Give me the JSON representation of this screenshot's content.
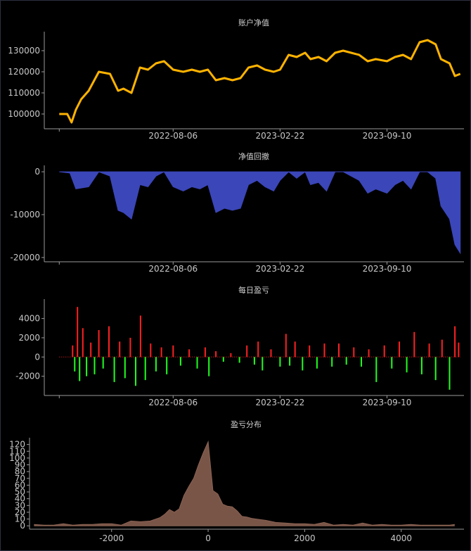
{
  "chart_data": [
    {
      "type": "line",
      "title": "账户净值",
      "xlabel": "",
      "ylabel": "",
      "x_ticks": [
        "2022-08-06",
        "2023-02-22",
        "2023-09-10"
      ],
      "y_ticks": [
        "100000",
        "110000",
        "120000",
        "130000"
      ],
      "ylim": [
        93000,
        138000
      ],
      "color": "#ffb300",
      "series": [
        {
          "x": [
            "2022-01-05",
            "2022-01-20",
            "2022-01-28",
            "2022-02-05",
            "2022-02-15",
            "2022-03-01",
            "2022-03-20",
            "2022-04-10",
            "2022-04-25",
            "2022-05-05",
            "2022-05-20",
            "2022-06-05",
            "2022-06-20",
            "2022-07-05",
            "2022-07-20",
            "2022-08-06",
            "2022-08-25",
            "2022-09-10",
            "2022-09-25",
            "2022-10-10",
            "2022-10-25",
            "2022-11-10",
            "2022-11-25",
            "2022-12-10",
            "2022-12-25",
            "2023-01-10",
            "2023-01-25",
            "2023-02-10",
            "2023-02-22",
            "2023-03-10",
            "2023-03-25",
            "2023-04-10",
            "2023-04-20",
            "2023-05-05",
            "2023-05-20",
            "2023-06-05",
            "2023-06-20",
            "2023-07-05",
            "2023-07-20",
            "2023-08-05",
            "2023-08-20",
            "2023-09-10",
            "2023-09-25",
            "2023-10-10",
            "2023-10-25",
            "2023-11-10",
            "2023-11-25",
            "2023-12-10",
            "2023-12-20",
            "2024-01-05",
            "2024-01-15",
            "2024-01-25"
          ],
          "y": [
            100000,
            100000,
            96000,
            102000,
            107000,
            111000,
            120000,
            119000,
            111000,
            112000,
            110000,
            122000,
            121000,
            124000,
            125000,
            121000,
            120000,
            121000,
            120000,
            121000,
            116000,
            117000,
            116000,
            117000,
            122000,
            123000,
            121000,
            120000,
            121000,
            128000,
            127000,
            129000,
            126000,
            127000,
            125000,
            129000,
            130000,
            129000,
            128000,
            125000,
            126000,
            125000,
            127000,
            128000,
            126000,
            134000,
            135000,
            133000,
            126000,
            124000,
            118000,
            119000
          ]
        }
      ]
    },
    {
      "type": "area",
      "title": "净值回撤",
      "xlabel": "",
      "ylabel": "",
      "x_ticks": [
        "2022-08-06",
        "2023-02-22",
        "2023-09-10"
      ],
      "y_ticks": [
        "0",
        "-10000",
        "-20000"
      ],
      "ylim": [
        -21000,
        1000
      ],
      "color": "#3b46b8",
      "series": [
        {
          "x": [
            "2022-01-05",
            "2022-01-25",
            "2022-02-05",
            "2022-03-01",
            "2022-03-20",
            "2022-04-10",
            "2022-04-25",
            "2022-05-05",
            "2022-05-20",
            "2022-06-05",
            "2022-06-20",
            "2022-07-05",
            "2022-07-20",
            "2022-08-06",
            "2022-08-25",
            "2022-09-10",
            "2022-09-25",
            "2022-10-10",
            "2022-10-25",
            "2022-11-10",
            "2022-11-25",
            "2022-12-10",
            "2022-12-25",
            "2023-01-10",
            "2023-01-25",
            "2023-02-10",
            "2023-02-22",
            "2023-03-10",
            "2023-03-25",
            "2023-04-10",
            "2023-04-20",
            "2023-05-05",
            "2023-05-20",
            "2023-06-05",
            "2023-06-20",
            "2023-07-05",
            "2023-07-20",
            "2023-08-05",
            "2023-08-20",
            "2023-09-10",
            "2023-09-25",
            "2023-10-10",
            "2023-10-25",
            "2023-11-10",
            "2023-11-25",
            "2023-12-10",
            "2023-12-20",
            "2024-01-05",
            "2024-01-15",
            "2024-01-25"
          ],
          "y": [
            0,
            -300,
            -4000,
            -3500,
            0,
            -1000,
            -9000,
            -9500,
            -11000,
            -3000,
            -3500,
            -1000,
            0,
            -3500,
            -4500,
            -3500,
            -4000,
            -3000,
            -9500,
            -8500,
            -9000,
            -8500,
            -3000,
            -2000,
            -3500,
            -4500,
            -2000,
            0,
            -1500,
            0,
            -3000,
            -2500,
            -4500,
            0,
            0,
            -1000,
            -2000,
            -5000,
            -4000,
            -5000,
            -3000,
            -2000,
            -4000,
            0,
            0,
            -1500,
            -8000,
            -11000,
            -17000,
            -19000
          ]
        }
      ]
    },
    {
      "type": "bar",
      "title": "每日盈亏",
      "xlabel": "",
      "ylabel": "",
      "x_ticks": [
        "2022-08-06",
        "2023-02-22",
        "2023-09-10"
      ],
      "y_ticks": [
        "4000",
        "2000",
        "0",
        "-2000"
      ],
      "ylim": [
        -4000,
        5800
      ],
      "positive_color": "#ff2020",
      "negative_color": "#20ff20",
      "series": [
        {
          "name": "",
          "x": [
            "2022-01-30",
            "2022-02-03",
            "2022-02-08",
            "2022-02-12",
            "2022-02-18",
            "2022-02-25",
            "2022-03-05",
            "2022-03-12",
            "2022-03-20",
            "2022-03-28",
            "2022-04-08",
            "2022-04-18",
            "2022-04-28",
            "2022-05-08",
            "2022-05-18",
            "2022-05-28",
            "2022-06-06",
            "2022-06-15",
            "2022-06-25",
            "2022-07-05",
            "2022-07-15",
            "2022-07-25",
            "2022-08-06",
            "2022-08-20",
            "2022-09-05",
            "2022-09-20",
            "2022-10-05",
            "2022-10-12",
            "2022-10-25",
            "2022-11-08",
            "2022-11-22",
            "2022-12-08",
            "2022-12-22",
            "2023-01-05",
            "2023-01-12",
            "2023-01-20",
            "2023-02-05",
            "2023-02-22",
            "2023-03-05",
            "2023-03-12",
            "2023-03-22",
            "2023-04-05",
            "2023-04-18",
            "2023-05-02",
            "2023-05-16",
            "2023-05-30",
            "2023-06-12",
            "2023-06-26",
            "2023-07-10",
            "2023-07-24",
            "2023-08-07",
            "2023-08-21",
            "2023-09-05",
            "2023-09-19",
            "2023-10-03",
            "2023-10-17",
            "2023-10-31",
            "2023-11-14",
            "2023-11-28",
            "2023-12-10",
            "2023-12-22",
            "2024-01-05",
            "2024-01-15",
            "2024-01-22"
          ],
          "values": [
            1200,
            -1500,
            5200,
            -2500,
            3000,
            -2000,
            1500,
            -1800,
            2800,
            -1200,
            3200,
            -2600,
            1600,
            -2200,
            2000,
            -3000,
            4300,
            -2400,
            1400,
            -1500,
            1000,
            -1800,
            1200,
            -900,
            800,
            -1200,
            1000,
            -2000,
            600,
            -500,
            400,
            -600,
            1200,
            -800,
            1600,
            -1400,
            800,
            -1000,
            2400,
            -900,
            1600,
            -1400,
            1200,
            -1200,
            1400,
            -1000,
            1400,
            -800,
            1000,
            -1000,
            800,
            -2600,
            1200,
            -1200,
            1600,
            -1600,
            2600,
            -1800,
            1400,
            -2400,
            1800,
            -3400,
            3200,
            1500
          ]
        }
      ]
    },
    {
      "type": "area",
      "title": "盈亏分布",
      "xlabel": "",
      "ylabel": "",
      "x_ticks": [
        "-2000",
        "0",
        "2000",
        "4000"
      ],
      "y_ticks": [
        "0",
        "10",
        "20",
        "30",
        "40",
        "50",
        "60",
        "70",
        "80",
        "90",
        "100",
        "110",
        "120"
      ],
      "xlim": [
        -3700,
        5300
      ],
      "ylim": [
        -5,
        130
      ],
      "color": "#795548",
      "series": [
        {
          "x": [
            -3600,
            -3400,
            -3200,
            -3000,
            -2800,
            -2600,
            -2400,
            -2200,
            -2000,
            -1800,
            -1600,
            -1400,
            -1200,
            -1000,
            -900,
            -800,
            -700,
            -600,
            -500,
            -400,
            -300,
            -200,
            -100,
            0,
            100,
            200,
            300,
            400,
            500,
            600,
            700,
            800,
            900,
            1000,
            1200,
            1400,
            1600,
            1800,
            2000,
            2200,
            2400,
            2600,
            2800,
            3000,
            3200,
            3400,
            3600,
            3800,
            4000,
            4200,
            4400,
            4600,
            4800,
            5000,
            5100
          ],
          "y": [
            2,
            1,
            1,
            3,
            1,
            2,
            2,
            3,
            3,
            1,
            7,
            6,
            7,
            12,
            17,
            24,
            20,
            25,
            45,
            58,
            70,
            90,
            108,
            124,
            52,
            47,
            32,
            29,
            28,
            22,
            14,
            13,
            11,
            10,
            8,
            5,
            4,
            3,
            3,
            2,
            5,
            1,
            2,
            1,
            4,
            1,
            2,
            1,
            1,
            2,
            1,
            1,
            1,
            1,
            2
          ]
        }
      ]
    }
  ]
}
